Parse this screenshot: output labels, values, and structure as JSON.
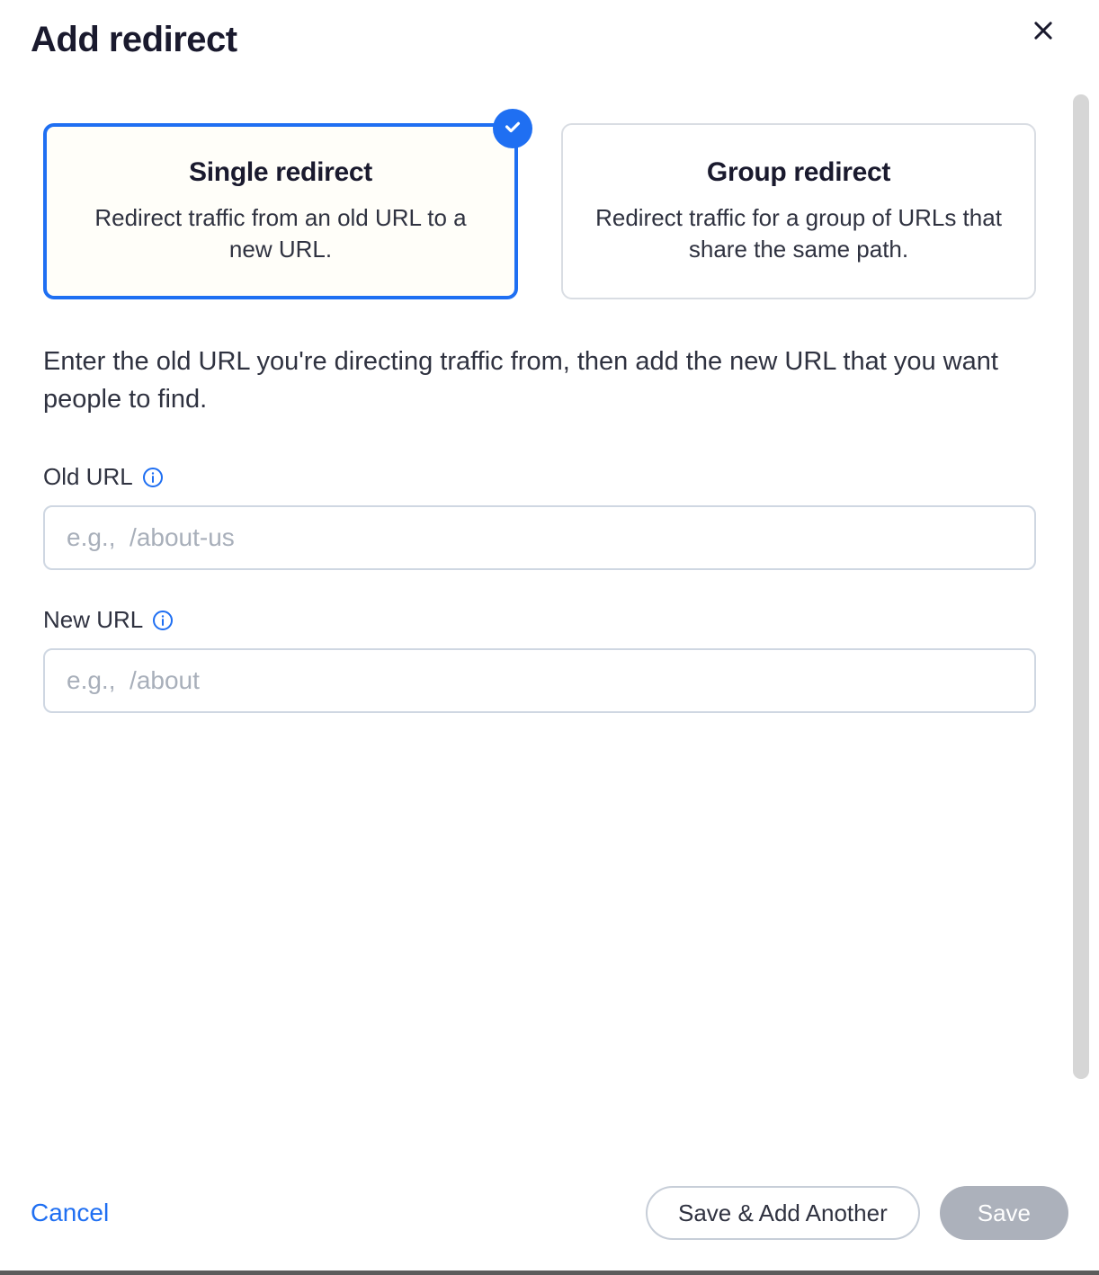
{
  "modal": {
    "title": "Add redirect"
  },
  "options": {
    "single": {
      "title": "Single redirect",
      "description": "Redirect traffic from an old URL to a new URL."
    },
    "group": {
      "title": "Group redirect",
      "description": "Redirect traffic for a group of URLs that share the same path."
    }
  },
  "instruction": "Enter the old URL you're directing traffic from, then add the new URL that you want people to find.",
  "fields": {
    "old_url": {
      "label": "Old URL",
      "placeholder": "e.g.,  /about-us"
    },
    "new_url": {
      "label": "New URL",
      "placeholder": "e.g.,  /about"
    }
  },
  "footer": {
    "cancel": "Cancel",
    "save_add": "Save & Add Another",
    "save": "Save"
  }
}
